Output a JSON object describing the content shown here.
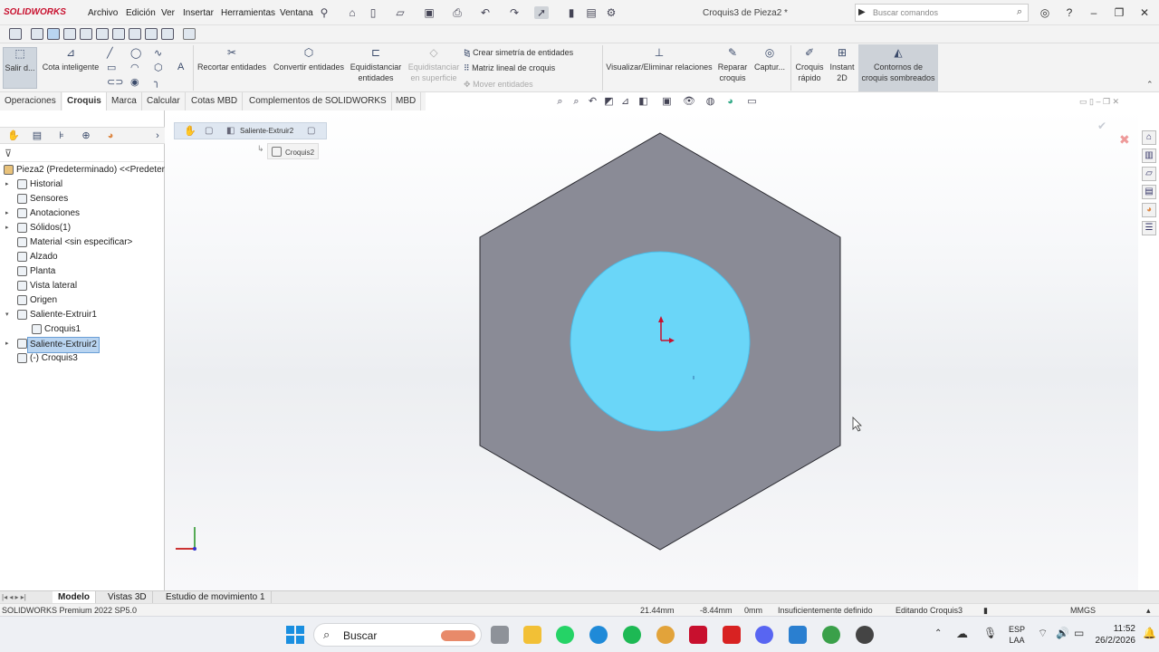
{
  "app": {
    "logo_text": "SOLIDWORKS",
    "window_title": "Croquis3 de Pieza2 *",
    "menu": [
      "Archivo",
      "Edición",
      "Ver",
      "Insertar",
      "Herramientas",
      "Ventana"
    ],
    "search_placeholder": "Buscar comandos"
  },
  "command_manager": {
    "exit": "Salir d...",
    "smart_dim": "Cota inteligente",
    "trim": "Recortar entidades",
    "convert": "Convertir entidades",
    "offset_line1": "Equidistanciar",
    "offset_line2": "entidades",
    "offset_surface_line1": "Equidistanciar",
    "offset_surface_line2": "en superficie",
    "mirror": "Crear simetría de entidades",
    "linear_pattern": "Matriz lineal de croquis",
    "move": "Mover entidades",
    "display_relations": "Visualizar/Eliminar relaciones",
    "repair_line1": "Reparar",
    "repair_line2": "croquis",
    "capture": "Captur...",
    "rapid_line1": "Croquis",
    "rapid_line2": "rápido",
    "instant_line1": "Instant",
    "instant_line2": "2D",
    "shaded_line1": "Contornos de",
    "shaded_line2": "croquis sombreados"
  },
  "tabs": [
    "Operaciones",
    "Croquis",
    "Marca",
    "Calcular",
    "Cotas MBD",
    "Complementos de SOLIDWORKS",
    "MBD"
  ],
  "active_tab": "Croquis",
  "tree": {
    "root": "Pieza2 (Predeterminado) <<Predeter",
    "items": [
      {
        "label": "Historial",
        "indent": 0,
        "expandable": true
      },
      {
        "label": "Sensores",
        "indent": 0,
        "expandable": false
      },
      {
        "label": "Anotaciones",
        "indent": 0,
        "expandable": true
      },
      {
        "label": "Sólidos(1)",
        "indent": 0,
        "expandable": true
      },
      {
        "label": "Material <sin especificar>",
        "indent": 0,
        "expandable": false
      },
      {
        "label": "Alzado",
        "indent": 0,
        "expandable": false
      },
      {
        "label": "Planta",
        "indent": 0,
        "expandable": false
      },
      {
        "label": "Vista lateral",
        "indent": 0,
        "expandable": false
      },
      {
        "label": "Origen",
        "indent": 0,
        "expandable": false
      },
      {
        "label": "Saliente-Extruir1",
        "indent": 0,
        "expandable": true
      },
      {
        "label": "Croquis1",
        "indent": 1,
        "expandable": false
      },
      {
        "label": "Saliente-Extruir2",
        "indent": 0,
        "expandable": true,
        "selected": true
      },
      {
        "label": "(-) Croquis3",
        "indent": 0,
        "expandable": false
      }
    ]
  },
  "breadcrumb": {
    "feature": "Saliente-Extruir2",
    "sketch": "Croquis2"
  },
  "bottom_tabs": [
    "Modelo",
    "Vistas 3D",
    "Estudio de movimiento 1"
  ],
  "active_bottom_tab": "Modelo",
  "status": {
    "product": "SOLIDWORKS Premium 2022 SP5.0",
    "x": "21.44mm",
    "y": "-8.44mm",
    "z": "0mm",
    "definition": "Insuficientemente definido",
    "editing": "Editando Croquis3",
    "units": "MMGS"
  },
  "taskbar": {
    "search_label": "Buscar",
    "lang_line1": "ESP",
    "lang_line2": "LAA",
    "time": "11:52",
    "date": "26/2/2026"
  },
  "colors": {
    "hexagon": "#8a8b96",
    "circle": "#6ad6f8",
    "selection": "#b9d4f0",
    "brand": "#c8102e"
  }
}
